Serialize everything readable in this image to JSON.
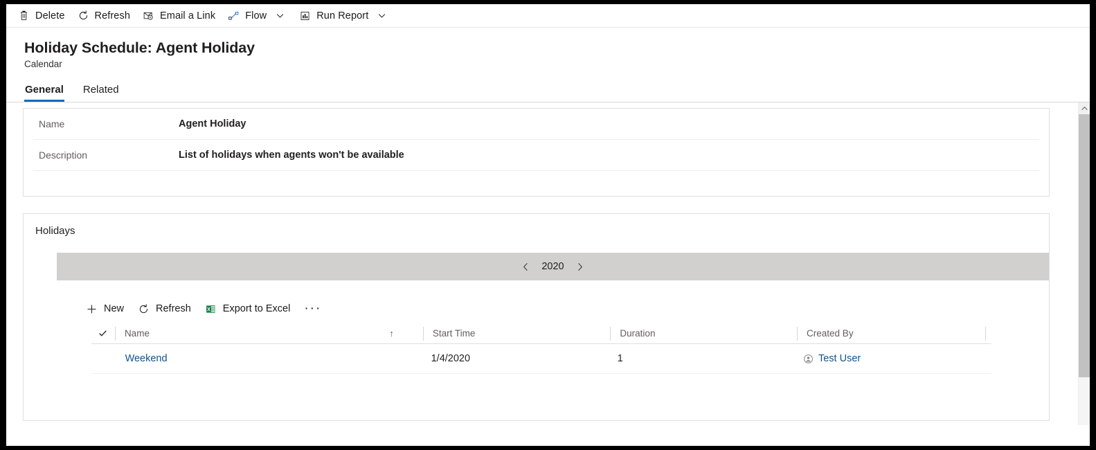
{
  "commandbar": {
    "items": [
      {
        "label": "Delete",
        "icon": "trash-icon",
        "has_caret": false
      },
      {
        "label": "Refresh",
        "icon": "refresh-icon",
        "has_caret": false
      },
      {
        "label": "Email a Link",
        "icon": "email-link-icon",
        "has_caret": false
      },
      {
        "label": "Flow",
        "icon": "flow-icon",
        "has_caret": true
      },
      {
        "label": "Run Report",
        "icon": "run-report-icon",
        "has_caret": true
      }
    ]
  },
  "header": {
    "title": "Holiday Schedule: Agent Holiday",
    "subtitle": "Calendar",
    "tabs": [
      {
        "label": "General",
        "active": true
      },
      {
        "label": "Related",
        "active": false
      }
    ]
  },
  "form": {
    "rows": [
      {
        "label": "Name",
        "value": "Agent Holiday"
      },
      {
        "label": "Description",
        "value": "List of holidays when agents won't be available"
      }
    ]
  },
  "holidays": {
    "section_title": "Holidays",
    "year_nav": {
      "prev_icon": "chevron-left-icon",
      "year": "2020",
      "next_icon": "chevron-right-icon"
    },
    "subgrid_commands": [
      {
        "label": "New",
        "icon": "plus-icon"
      },
      {
        "label": "Refresh",
        "icon": "refresh-icon"
      },
      {
        "label": "Export to Excel",
        "icon": "excel-icon"
      }
    ],
    "overflow_label": "···",
    "grid": {
      "select_all_icon": "checkmark-icon",
      "columns": [
        {
          "label": "Name",
          "sorted": true,
          "sort_icon": "↑"
        },
        {
          "label": "Start Time",
          "sorted": false,
          "sort_icon": ""
        },
        {
          "label": "Duration",
          "sorted": false,
          "sort_icon": ""
        },
        {
          "label": "Created By",
          "sorted": false,
          "sort_icon": ""
        }
      ],
      "rows": [
        {
          "name": "Weekend",
          "start_time": "1/4/2020",
          "duration": "1",
          "created_by": "Test User",
          "created_by_icon": "user-avatar-icon"
        }
      ]
    }
  },
  "colors": {
    "accent": "#0f6cbd",
    "link": "#0f548c",
    "year_bar": "#d2d0ce",
    "border": "#e1dfdd",
    "text": "#201f1e",
    "muted": "#605e5c"
  },
  "scrollbar": {
    "up_arrow_icon": "caret-up-icon"
  }
}
